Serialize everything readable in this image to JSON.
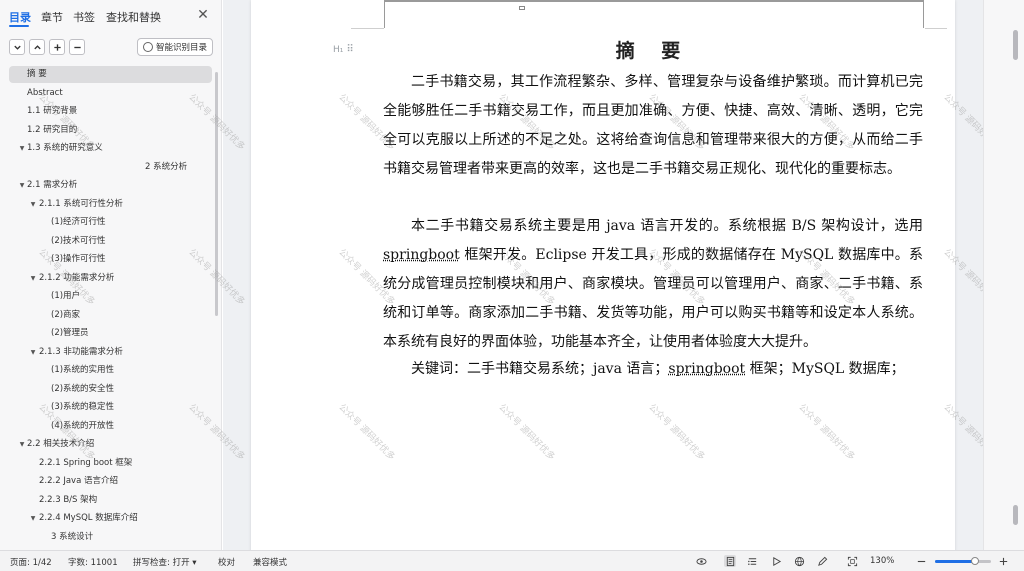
{
  "nav": {
    "tabs": [
      "目录",
      "章节",
      "书签",
      "查找和替换"
    ],
    "active_tab": 0,
    "smart_toc_label": "智能识别目录",
    "toc": [
      {
        "label": "摘 要",
        "level": 0,
        "arrow": "",
        "selected": true
      },
      {
        "label": "Abstract",
        "level": 0,
        "arrow": ""
      },
      {
        "label": "1.1  研究背景",
        "level": 0,
        "arrow": ""
      },
      {
        "label": "1.2  研究目的",
        "level": 0,
        "arrow": ""
      },
      {
        "label": "1.3    系统的研究意义",
        "level": 0,
        "arrow": "▼"
      },
      {
        "label": "2 系统分析",
        "level": 9,
        "arrow": ""
      },
      {
        "label": "2.1 需求分析",
        "level": 0,
        "arrow": "▼"
      },
      {
        "label": "2.1.1  系统可行性分析",
        "level": 1,
        "arrow": "▼"
      },
      {
        "label": "(1)经济可行性",
        "level": 2,
        "arrow": ""
      },
      {
        "label": "(2)技术可行性",
        "level": 2,
        "arrow": ""
      },
      {
        "label": "(3)操作可行性",
        "level": 2,
        "arrow": ""
      },
      {
        "label": "2.1.2  功能需求分析",
        "level": 1,
        "arrow": "▼"
      },
      {
        "label": "(1)用户",
        "level": 2,
        "arrow": ""
      },
      {
        "label": "(2)商家",
        "level": 2,
        "arrow": ""
      },
      {
        "label": "(2)管理员",
        "level": 2,
        "arrow": ""
      },
      {
        "label": "2.1.3  非功能需求分析",
        "level": 1,
        "arrow": "▼"
      },
      {
        "label": "(1)系统的实用性",
        "level": 2,
        "arrow": ""
      },
      {
        "label": "(2)系统的安全性",
        "level": 2,
        "arrow": ""
      },
      {
        "label": "(3)系统的稳定性",
        "level": 2,
        "arrow": ""
      },
      {
        "label": "(4)系统的开放性",
        "level": 2,
        "arrow": ""
      },
      {
        "label": "2.2 相关技术介绍",
        "level": 0,
        "arrow": "▼"
      },
      {
        "label": "2.2.1 Spring boot 框架",
        "level": 1,
        "arrow": ""
      },
      {
        "label": "2.2.2 Java 语言介绍",
        "level": 1,
        "arrow": ""
      },
      {
        "label": "2.2.3 B/S 架构",
        "level": 1,
        "arrow": ""
      },
      {
        "label": "2.2.4 MySQL  数据库介绍",
        "level": 1,
        "arrow": "▼"
      },
      {
        "label": "3  系统设计",
        "level": 3,
        "arrow": ""
      }
    ]
  },
  "document": {
    "title": "摘 要",
    "heading_marker": "H₁",
    "paragraph1": "二手书籍交易，其工作流程繁杂、多样、管理复杂与设备维护繁琐。而计算机已完全能够胜任二手书籍交易工作，而且更加准确、方便、快捷、高效、清晰、透明，它完全可以克服以上所述的不足之处。这将给查询信息和管理带来很大的方便，从而给二手书籍交易管理者带来更高的效率，这也是二手书籍交易正规化、现代化的重要标志。",
    "paragraph2_a": "本二手书籍交易系统主要是用 java 语言开发的。系统根据 B/S 架构设计，选用",
    "paragraph2_ul": "springboot",
    "paragraph2_b": " 框架开发。Eclipse 开发工具，形成的数据储存在 MySQL 数据库中。系统分成管理员控制模块和用户、商家模块。管理员可以管理用户、商家、二手书籍、系统和订单等。商家添加二手书籍、发货等功能，用户可以购买书籍等和设定本人系统。本系统有良好的界面体验，功能基本齐全，让使用者体验度大大提升。",
    "keywords_label": "关键词：",
    "keywords_a": "二手书籍交易系统；java 语言；",
    "keywords_ul": "springboot",
    "keywords_b": " 框架；MySQL 数据库；",
    "watermark": "公众号 源码好优多"
  },
  "status": {
    "page": "页面: 1/42",
    "words": "字数: 11001",
    "spellcheck": "拼写检查: 打开",
    "proofread": "校对",
    "compat": "兼容模式",
    "zoom": "130%",
    "zoom_fraction": 0.72
  },
  "colors": {
    "accent": "#1f6fe5"
  }
}
